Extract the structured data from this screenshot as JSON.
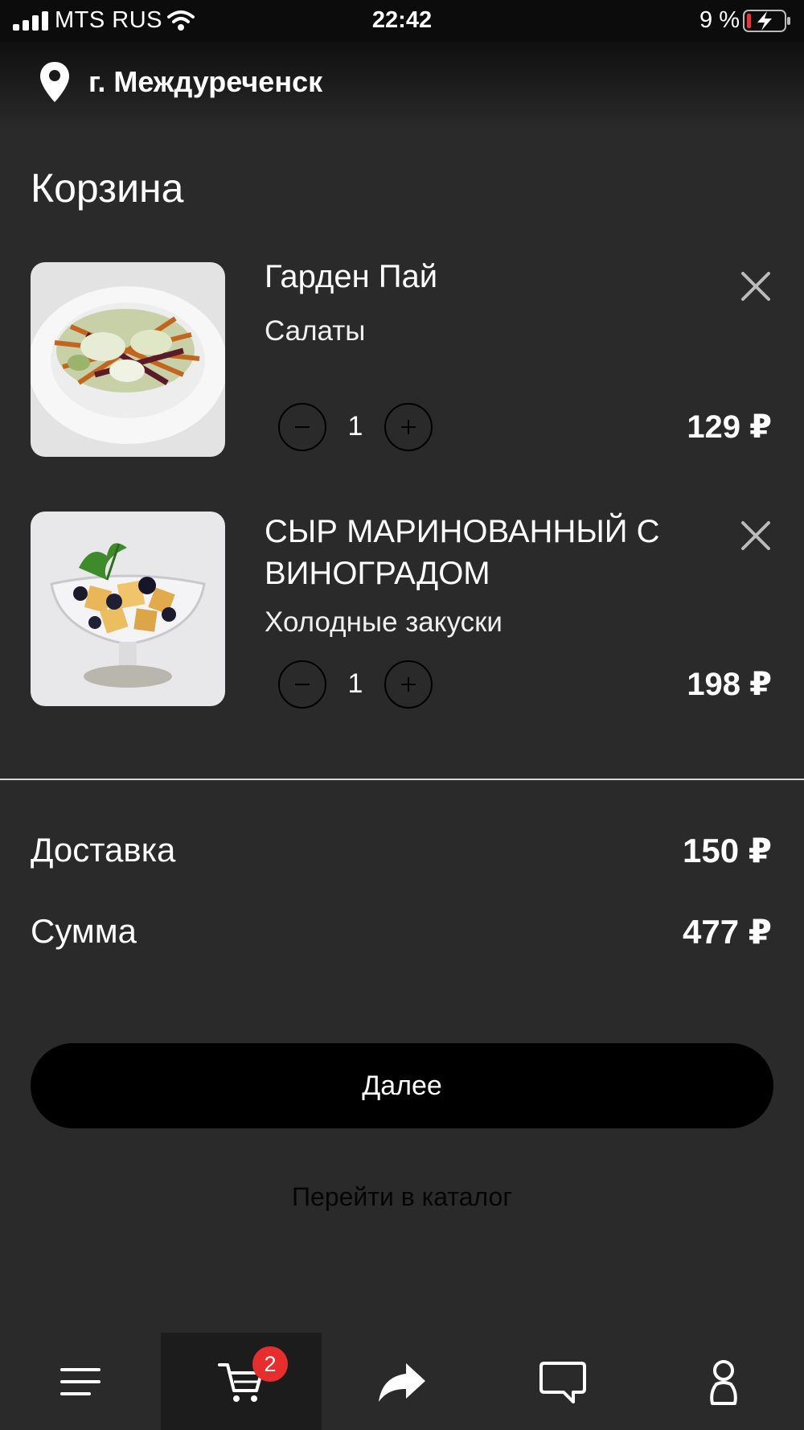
{
  "status_bar": {
    "carrier": "MTS RUS",
    "time": "22:42",
    "battery_percent": "9 %",
    "icons": [
      "signal-icon",
      "wifi-icon",
      "battery-charging-icon"
    ]
  },
  "header": {
    "location_icon": "location-pin-icon",
    "city": "г. Междуреченск"
  },
  "page": {
    "title": "Корзина"
  },
  "cart": {
    "items": [
      {
        "name": "Гарден Пай",
        "category": "Салаты",
        "quantity": "1",
        "price": "129 ₽",
        "image": "salad-photo"
      },
      {
        "name": "СЫР МАРИНОВАННЫЙ С ВИНОГРАДОМ",
        "category": "Холодные закуски",
        "quantity": "1",
        "price": "198 ₽",
        "image": "marinated-cheese-photo"
      }
    ]
  },
  "summary": {
    "delivery_label": "Доставка",
    "delivery_value": "150 ₽",
    "total_label": "Сумма",
    "total_value": "477 ₽"
  },
  "actions": {
    "next_label": "Далее",
    "catalog_label": "Перейти в каталог"
  },
  "tabbar": {
    "tabs": [
      {
        "icon": "menu-icon",
        "active": false
      },
      {
        "icon": "cart-icon",
        "active": true,
        "badge": "2"
      },
      {
        "icon": "share-icon",
        "active": false
      },
      {
        "icon": "chat-icon",
        "active": false
      },
      {
        "icon": "profile-icon",
        "active": false
      }
    ]
  },
  "colors": {
    "background": "#2a2a2a",
    "status_bar": "#0c0c0c",
    "button": "#000000",
    "badge": "#e62e2e",
    "text": "#ffffff"
  }
}
